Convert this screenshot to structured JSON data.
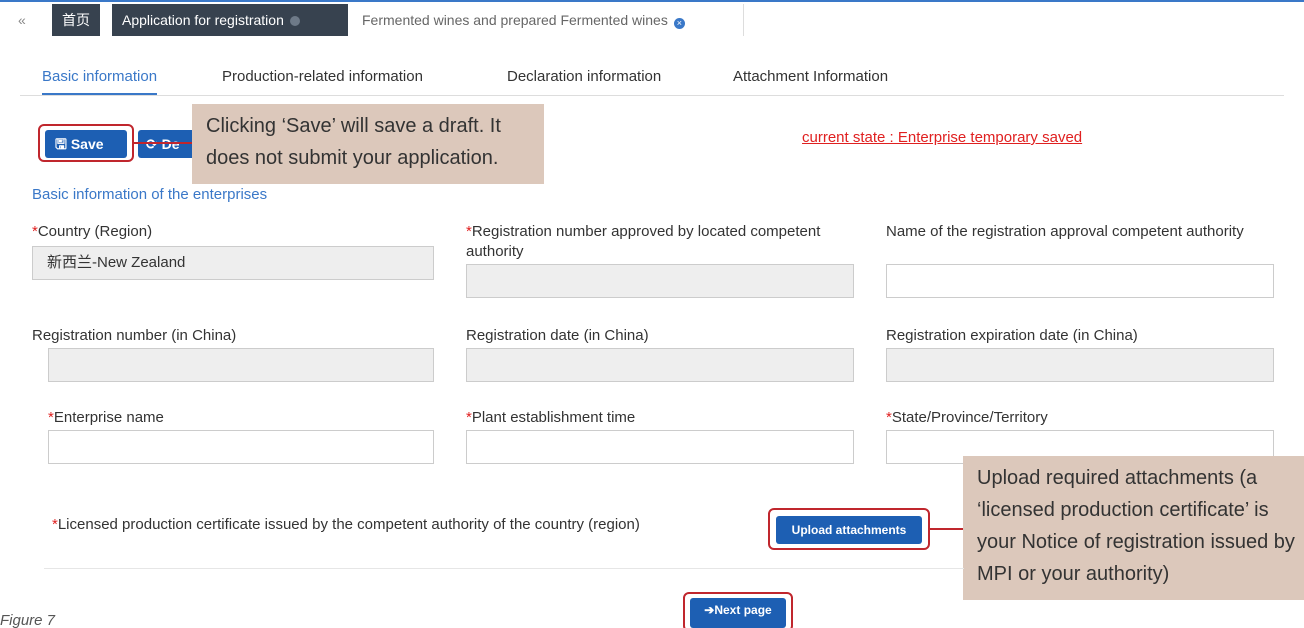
{
  "tabs": {
    "back_icon": "«",
    "home": "首页",
    "application": "Application for registration",
    "wine": "Fermented wines and prepared Fermented wines"
  },
  "subtabs": [
    "Basic information",
    "Production-related information",
    "Declaration information",
    "Attachment Information"
  ],
  "toolbar": {
    "save_label": "Save",
    "draft_label": "De"
  },
  "callouts": {
    "save": "Clicking ‘Save’ will save a draft. It does not submit your application.",
    "upload": "Upload required attachments (a ‘licensed production certificate’ is your Notice of registration issued by MPI or your authority)"
  },
  "state_text": "current state : Enterprise temporary saved",
  "section_title": "Basic information of the enterprises",
  "fields": {
    "country_label": "Country (Region)",
    "country_value": "新西兰-New Zealand",
    "regnum_approved_label": "Registration number approved by located competent authority",
    "approval_authority_label": "Name of the registration approval competent authority",
    "regnum_china_label": "Registration number (in China)",
    "regdate_china_label": "Registration date (in China)",
    "regexp_china_label": "Registration expiration date (in China)",
    "enterprise_name_label": "Enterprise name",
    "plant_time_label": "Plant establishment time",
    "state_province_label": "State/Province/Territory"
  },
  "required_marker": "*",
  "certificate_label": "Licensed production certificate issued by the competent authority of the country (region)",
  "upload_label": "Upload attachments",
  "next_label": "Next page",
  "figure_note": "Figure 7",
  "colors": {
    "accent": "#1d5fb3",
    "highlight_red": "#c0262d",
    "callout_bg": "#dcc8bb"
  }
}
